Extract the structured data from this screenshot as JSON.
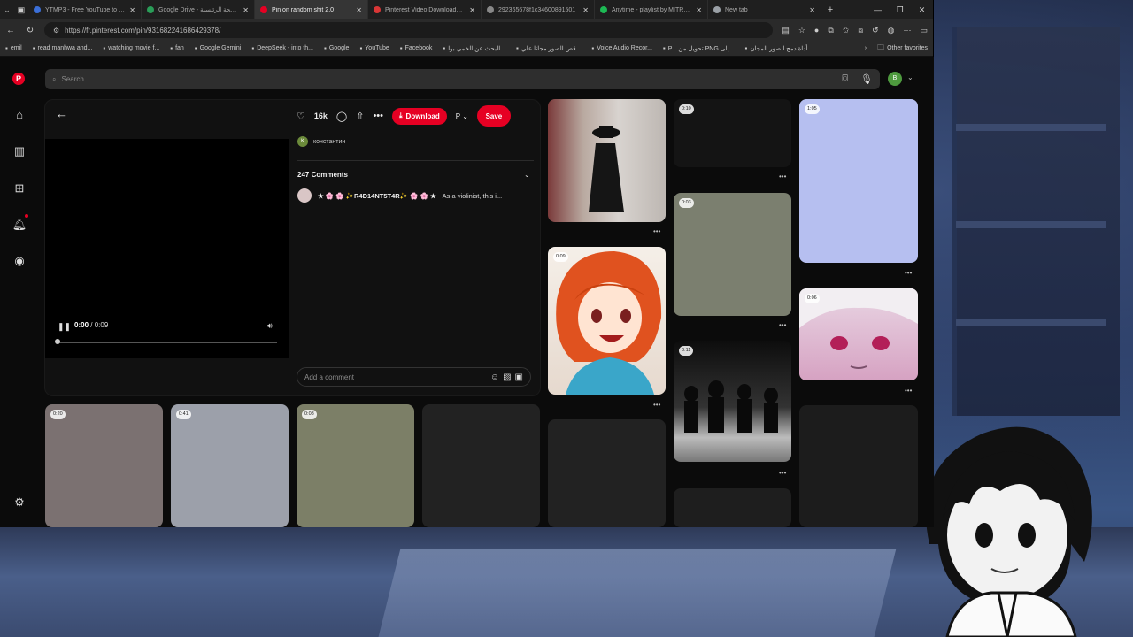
{
  "browser": {
    "tabs": [
      {
        "title": "YTMP3 - Free YouTube to MP3 C",
        "color": "#3b6fd8",
        "active": false
      },
      {
        "title": "Google Drive - الصفحة الرئيسية",
        "color": "#2a9d58",
        "active": false
      },
      {
        "title": "Pin on random shit 2.0",
        "color": "#e60023",
        "active": true
      },
      {
        "title": "Pinterest Video Downloader - Do",
        "color": "#d93636",
        "active": false
      },
      {
        "title": "292365678f1c34600891501",
        "color": "#888888",
        "active": false
      },
      {
        "title": "Anytime - playlist by MITROZE|",
        "color": "#1db954",
        "active": false
      },
      {
        "title": "New tab",
        "color": "#9aa0a6",
        "active": false
      }
    ],
    "url": "https://fr.pinterest.com/pin/931682241686429378/",
    "bookmarks": [
      "emil",
      "read manhwa and...",
      "watching movie f...",
      "fan",
      "Google Gemini",
      "DeepSeek - into th...",
      "Google",
      "YouTube",
      "Facebook",
      "البحث عن الخمي بوا...",
      "قص الصور مجانا علي...",
      "Voice Audio Recor...",
      "P... تحويل من PNG إلى...",
      "أداة دمج الصور المجان..."
    ],
    "other_favorites": "Other favorites"
  },
  "page": {
    "search_placeholder": "Search",
    "profile_initial": "B",
    "pin": {
      "likes": "16k",
      "download_label": "Download",
      "board_label": "P",
      "save_label": "Save",
      "creator_initial": "K",
      "creator_name": "константин",
      "comments_header": "247 Comments",
      "comment": {
        "user": "★ 🌸 🌸 ✨R4D14NT5T4R✨ 🌸 🌸 ★",
        "text": "As a violinist, this i..."
      },
      "comment_placeholder": "Add a comment",
      "video": {
        "current": "0:00",
        "duration": "/ 0:09",
        "progress": 0.0
      }
    },
    "tiles": [
      {
        "badge": "0:10",
        "kind": "plague-doctor"
      },
      {
        "badge": "0:09",
        "kind": "anime-redhair"
      },
      {
        "badge": "0:10",
        "kind": "dark"
      },
      {
        "badge": "0:03",
        "kind": "olive"
      },
      {
        "badge": "0:11",
        "kind": "shadows"
      },
      {
        "badge": "1:05",
        "kind": "lavender"
      },
      {
        "badge": "0:06",
        "kind": "anime-pink"
      },
      {
        "badge": "0:20",
        "kind": "mauve"
      },
      {
        "badge": "0:41",
        "kind": "grey-blue"
      },
      {
        "badge": "0:08",
        "kind": "olive"
      }
    ]
  },
  "colors": {
    "brand": "#e60023",
    "page_bg": "#0b0b0b"
  }
}
